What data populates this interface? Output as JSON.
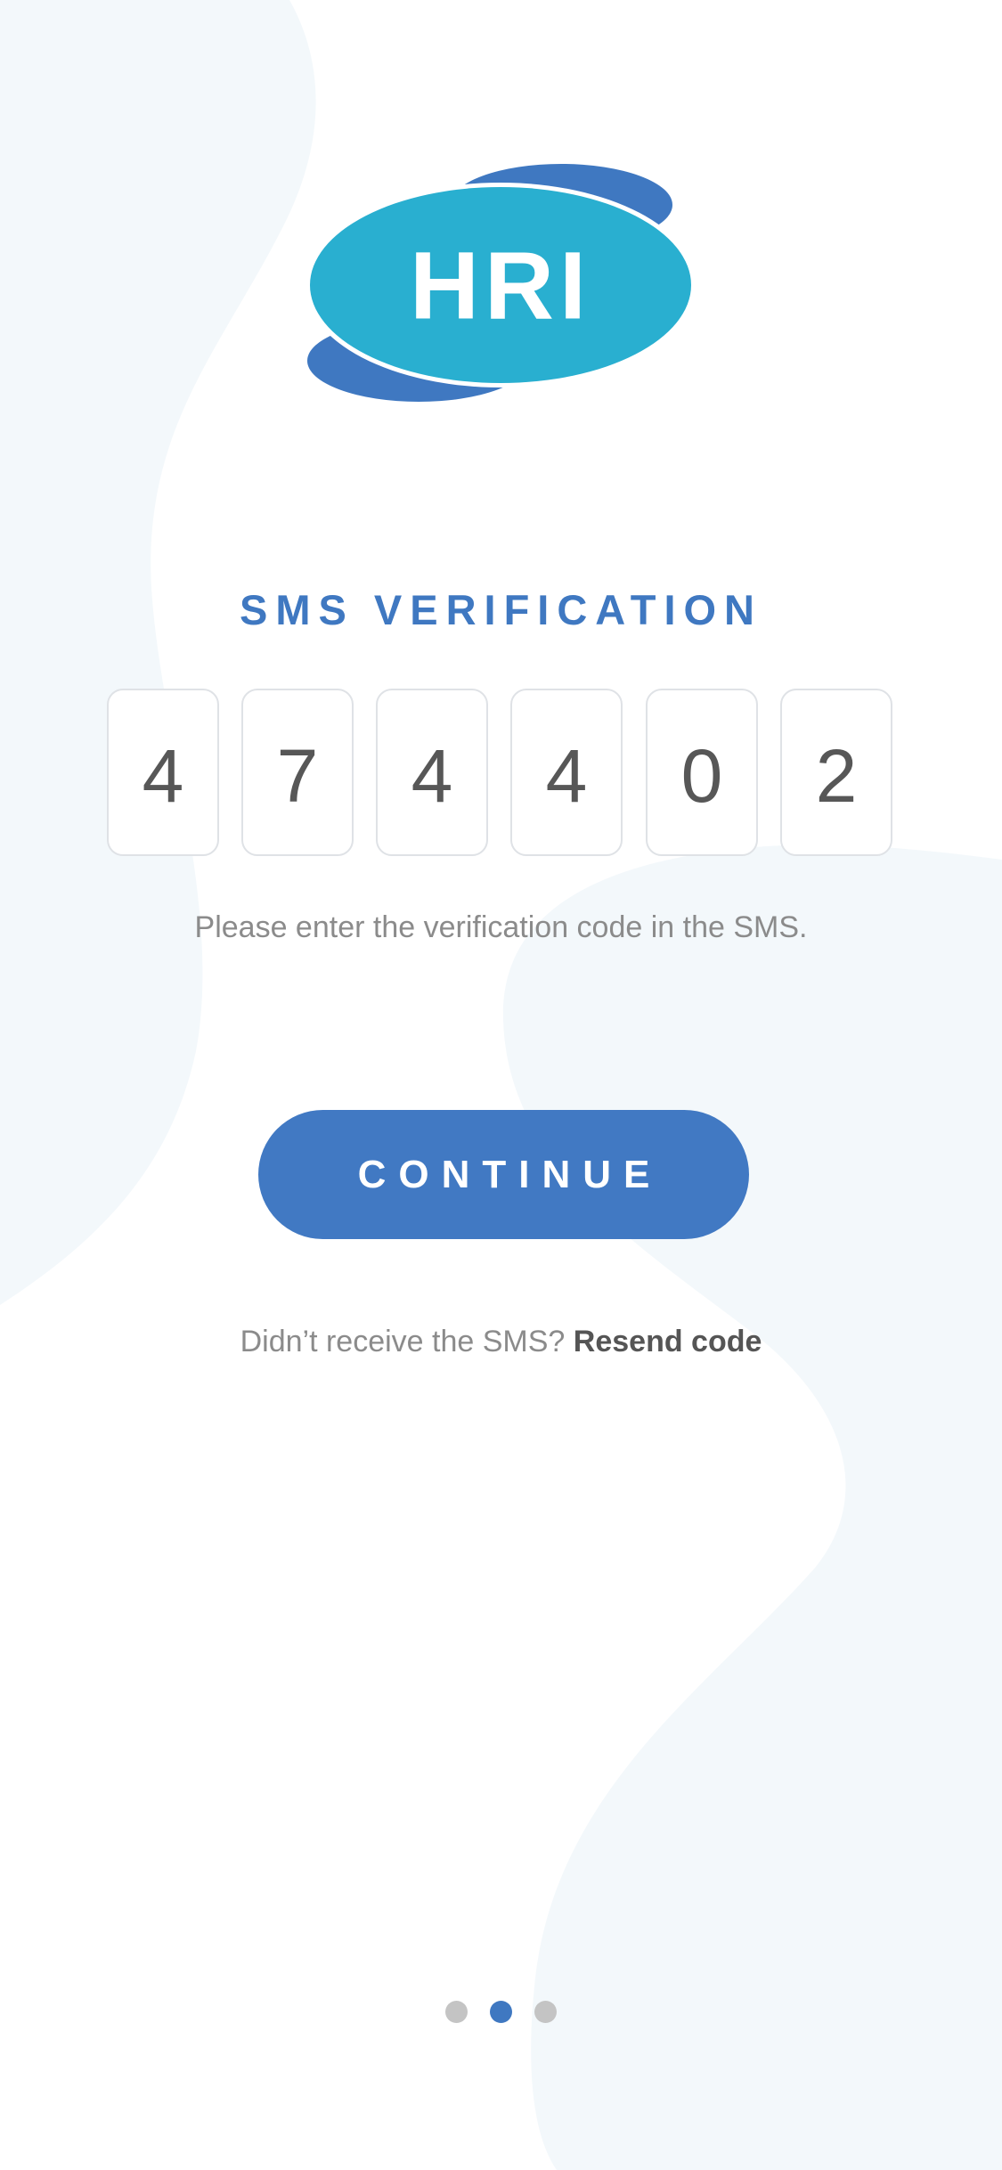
{
  "logo": {
    "text": "HRI",
    "primary_color": "#29afd0",
    "secondary_color": "#3f78c1"
  },
  "title": "SMS VERIFICATION",
  "code": {
    "digits": [
      "4",
      "7",
      "4",
      "4",
      "0",
      "2"
    ]
  },
  "hint": "Please enter the verification code in the SMS.",
  "continue_label": "CONTINUE",
  "resend": {
    "prompt": "Didn’t receive the SMS?",
    "link_label": "Resend code"
  },
  "pagination": {
    "total": 3,
    "active_index": 1
  },
  "colors": {
    "accent": "#4179c3",
    "background_shape": "#f3f8fb"
  }
}
